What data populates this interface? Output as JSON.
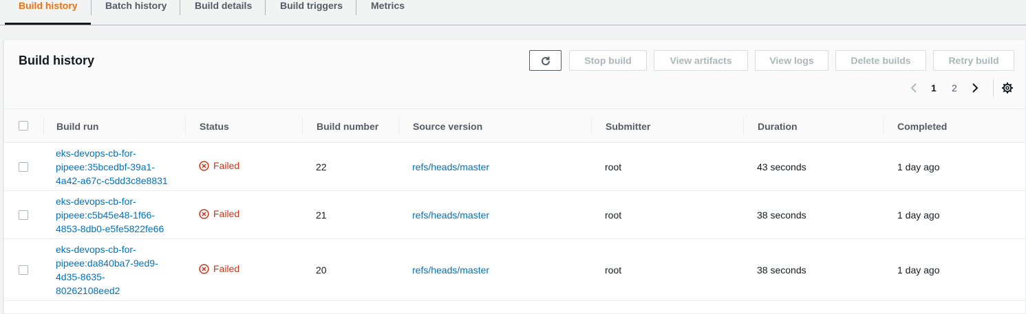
{
  "tabs": [
    {
      "label": "Build history",
      "active": true
    },
    {
      "label": "Batch history",
      "active": false
    },
    {
      "label": "Build details",
      "active": false
    },
    {
      "label": "Build triggers",
      "active": false
    },
    {
      "label": "Metrics",
      "active": false
    }
  ],
  "panel": {
    "title": "Build history",
    "buttons": {
      "refresh_icon": "refresh-icon",
      "stop": "Stop build",
      "artifacts": "View artifacts",
      "logs": "View logs",
      "delete": "Delete builds",
      "retry": "Retry build"
    },
    "pagination": {
      "pages": [
        "1",
        "2"
      ],
      "current": "1"
    }
  },
  "table": {
    "columns": [
      "Build run",
      "Status",
      "Build number",
      "Source version",
      "Submitter",
      "Duration",
      "Completed"
    ],
    "rows": [
      {
        "build_run_lines": [
          "eks-devops-cb-for-",
          "pipeee:35bcedbf-39a1-",
          "4a42-a67c-c5dd3c8e8831"
        ],
        "status": "Failed",
        "build_number": "22",
        "source_version": "refs/heads/master",
        "submitter": "root",
        "duration": "43 seconds",
        "completed": "1 day ago"
      },
      {
        "build_run_lines": [
          "eks-devops-cb-for-",
          "pipeee:c5b45e48-1f66-",
          "4853-8db0-e5fe5822fe66"
        ],
        "status": "Failed",
        "build_number": "21",
        "source_version": "refs/heads/master",
        "submitter": "root",
        "duration": "38 seconds",
        "completed": "1 day ago"
      },
      {
        "build_run_lines": [
          "eks-devops-cb-for-",
          "pipeee:da840ba7-9ed9-",
          "4d35-8635-",
          "80262108eed2"
        ],
        "status": "Failed",
        "build_number": "20",
        "source_version": "refs/heads/master",
        "submitter": "root",
        "duration": "38 seconds",
        "completed": "1 day ago"
      }
    ]
  },
  "colors": {
    "accent": "#ec7211",
    "link": "#0073bb",
    "error": "#d13212"
  }
}
